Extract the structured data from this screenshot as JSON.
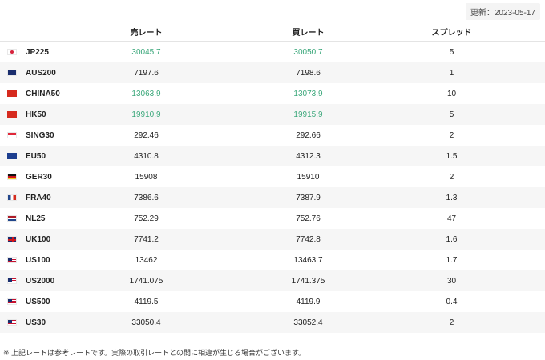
{
  "updated_label": "更新：2023-05-17",
  "headers": {
    "sell": "売レート",
    "buy": "買レート",
    "spread": "スプレッド"
  },
  "rows": [
    {
      "flag": "jp",
      "symbol": "JP225",
      "sell": "30045.7",
      "buy": "30050.7",
      "spread": "5",
      "highlight": true
    },
    {
      "flag": "au",
      "symbol": "AUS200",
      "sell": "7197.6",
      "buy": "7198.6",
      "spread": "1",
      "highlight": false
    },
    {
      "flag": "cn",
      "symbol": "CHINA50",
      "sell": "13063.9",
      "buy": "13073.9",
      "spread": "10",
      "highlight": true
    },
    {
      "flag": "hk",
      "symbol": "HK50",
      "sell": "19910.9",
      "buy": "19915.9",
      "spread": "5",
      "highlight": true
    },
    {
      "flag": "sg",
      "symbol": "SING30",
      "sell": "292.46",
      "buy": "292.66",
      "spread": "2",
      "highlight": false
    },
    {
      "flag": "eu",
      "symbol": "EU50",
      "sell": "4310.8",
      "buy": "4312.3",
      "spread": "1.5",
      "highlight": false
    },
    {
      "flag": "de",
      "symbol": "GER30",
      "sell": "15908",
      "buy": "15910",
      "spread": "2",
      "highlight": false
    },
    {
      "flag": "fr",
      "symbol": "FRA40",
      "sell": "7386.6",
      "buy": "7387.9",
      "spread": "1.3",
      "highlight": false
    },
    {
      "flag": "nl",
      "symbol": "NL25",
      "sell": "752.29",
      "buy": "752.76",
      "spread": "47",
      "highlight": false
    },
    {
      "flag": "uk",
      "symbol": "UK100",
      "sell": "7741.2",
      "buy": "7742.8",
      "spread": "1.6",
      "highlight": false
    },
    {
      "flag": "us",
      "symbol": "US100",
      "sell": "13462",
      "buy": "13463.7",
      "spread": "1.7",
      "highlight": false
    },
    {
      "flag": "us",
      "symbol": "US2000",
      "sell": "1741.075",
      "buy": "1741.375",
      "spread": "30",
      "highlight": false
    },
    {
      "flag": "us",
      "symbol": "US500",
      "sell": "4119.5",
      "buy": "4119.9",
      "spread": "0.4",
      "highlight": false
    },
    {
      "flag": "us",
      "symbol": "US30",
      "sell": "33050.4",
      "buy": "33052.4",
      "spread": "2",
      "highlight": false
    }
  ],
  "note": "※ 上記レートは参考レートです。実際の取引レートとの間に相違が生じる場合がございます。",
  "colors": {
    "up": "#3aa77a",
    "alt_row": "#f6f6f6"
  }
}
